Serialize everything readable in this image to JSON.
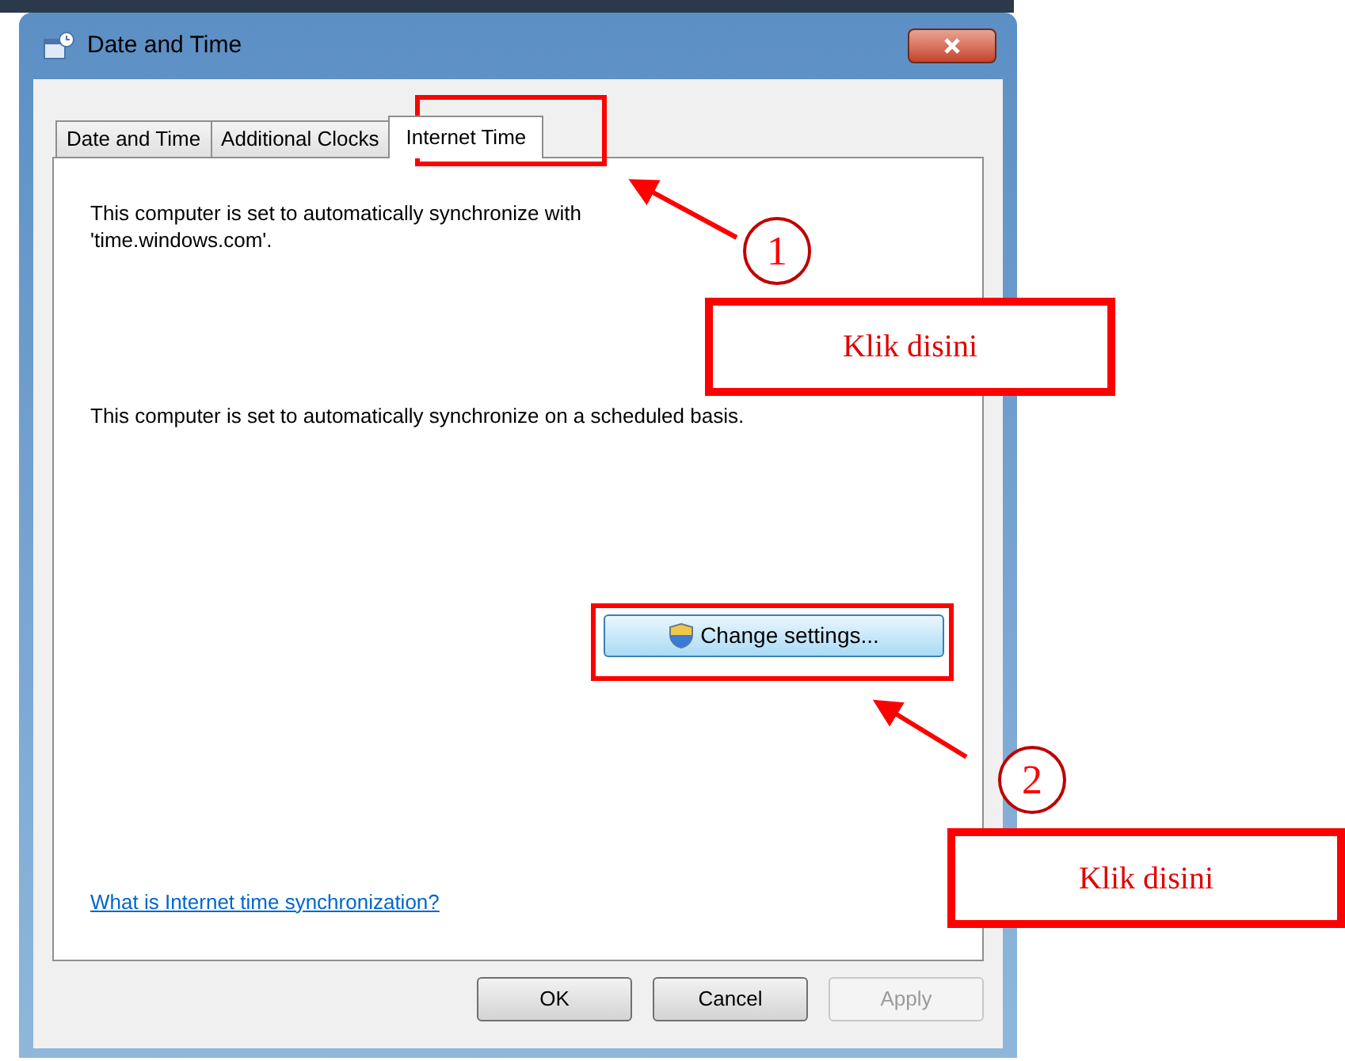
{
  "window": {
    "title": "Date and Time"
  },
  "tabs": [
    {
      "label": "Date and Time",
      "selected": false
    },
    {
      "label": "Additional Clocks",
      "selected": false
    },
    {
      "label": "Internet Time",
      "selected": true
    }
  ],
  "messages": [
    "This computer is set to automatically synchronize with 'time.windows.com'.",
    "This computer is set to automatically synchronize on a scheduled basis."
  ],
  "change_button": {
    "label": "Change settings..."
  },
  "help_link": "What is Internet time synchronization?",
  "buttons": [
    {
      "label": "OK",
      "disabled": false
    },
    {
      "label": "Cancel",
      "disabled": false
    },
    {
      "label": "Apply",
      "disabled": true
    }
  ],
  "annotations": [
    {
      "number": "1",
      "label": "Klik disini"
    },
    {
      "number": "2",
      "label": "Klik disini"
    }
  ]
}
